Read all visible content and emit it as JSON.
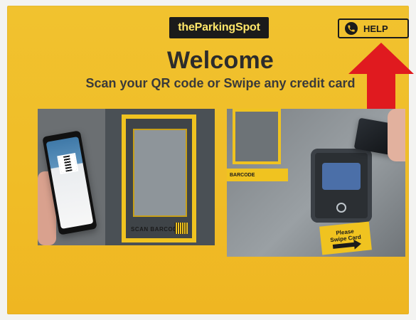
{
  "brand": {
    "logo_text": "theParkingSpot"
  },
  "help": {
    "label": "HELP"
  },
  "hero": {
    "title": "Welcome",
    "subtitle": "Scan your QR code or Swipe any credit card"
  },
  "photos": {
    "left": {
      "machine_label": "SCAN BARCODE"
    },
    "right": {
      "strip_label": "BARCODE",
      "sign_line1": "Please",
      "sign_line2": "Swipe Card"
    }
  },
  "colors": {
    "screen": "#f0bd27",
    "logo_bg": "#1b1b1b",
    "logo_text": "#ffe76a",
    "arrow": "#e01a1f",
    "text_dark": "#2c2c2c"
  },
  "icons": {
    "help": "phone-icon",
    "pointer": "up-arrow-icon"
  }
}
